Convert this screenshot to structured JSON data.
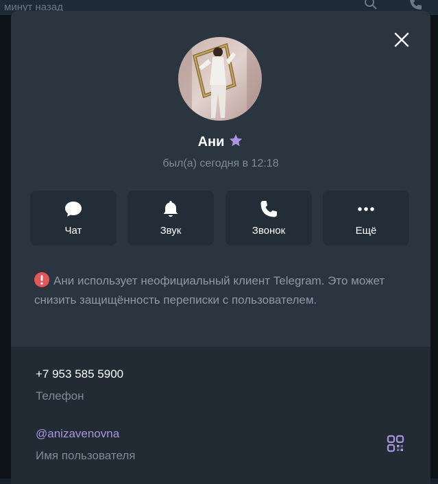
{
  "background": {
    "top_text": "минут назад"
  },
  "profile": {
    "name": "Ани",
    "status": "был(а) сегодня в 12:18"
  },
  "actions": [
    {
      "label": "Чат",
      "icon": "chat-bubble-icon"
    },
    {
      "label": "Звук",
      "icon": "bell-icon"
    },
    {
      "label": "Звонок",
      "icon": "phone-icon"
    },
    {
      "label": "Ещё",
      "icon": "more-dots-icon"
    }
  ],
  "warning": {
    "text": "Ани использует неофициальный клиент Telegram. Это может снизить защищённость переписки с пользователем."
  },
  "info": {
    "phone_value": "+7 953 585 5900",
    "phone_label": "Телефон",
    "username_value": "@anizavenovna",
    "username_label": "Имя пользователя"
  },
  "colors": {
    "dialog_bg": "#2a3540",
    "button_bg": "#222d38",
    "accent_purple": "#a996e0",
    "warning_red": "#e2565a",
    "muted_text": "#7f8b96"
  }
}
